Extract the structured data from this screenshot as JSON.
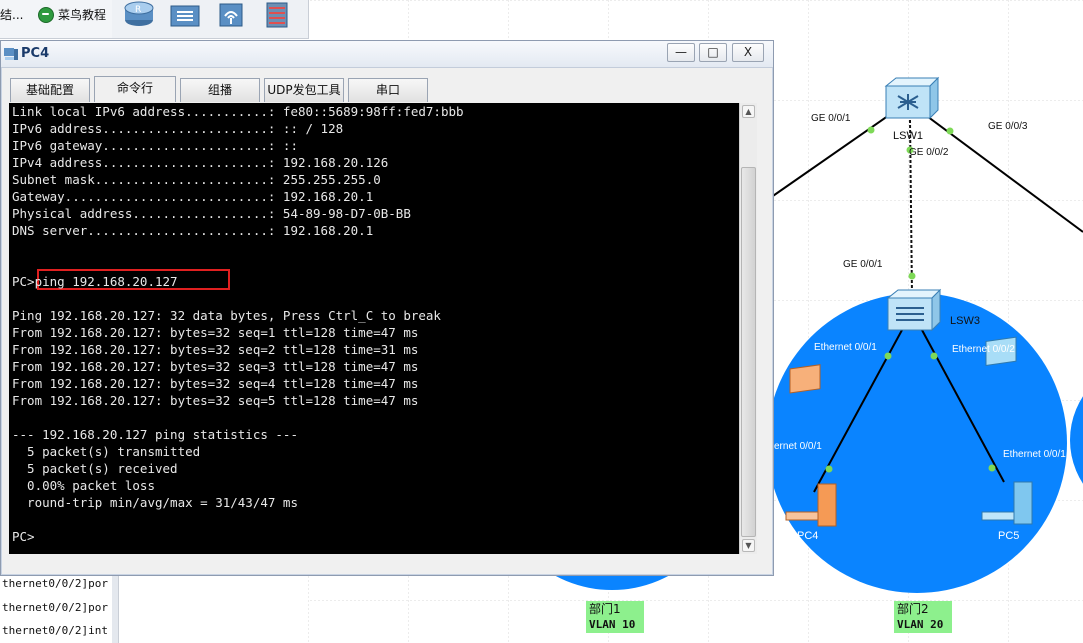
{
  "left_panel": {
    "tab_first": "结...",
    "tab_second": "菜鸟教程",
    "log_lines": [
      "thernet0/0/2]por",
      "thernet0/0/2]por",
      "thernet0/0/2]int"
    ]
  },
  "toolbar": {
    "icons": [
      "router-icon",
      "switch-icon",
      "wireless-icon",
      "firewall-icon"
    ]
  },
  "window": {
    "title": "PC4",
    "min_label": "—",
    "max_label": "□",
    "close_label": "X",
    "tabs": [
      "基础配置",
      "命令行",
      "组播",
      "UDP发包工具",
      "串口"
    ],
    "active_tab": "命令行"
  },
  "console": {
    "lines": [
      "Link local IPv6 address...........: fe80::5689:98ff:fed7:bbb",
      "IPv6 address......................: :: / 128",
      "IPv6 gateway......................: ::",
      "IPv4 address......................: 192.168.20.126",
      "Subnet mask.......................: 255.255.255.0",
      "Gateway...........................: 192.168.20.1",
      "Physical address..................: 54-89-98-D7-0B-BB",
      "DNS server........................: 192.168.20.1",
      "",
      "",
      "PC>ping 192.168.20.127",
      "",
      "Ping 192.168.20.127: 32 data bytes, Press Ctrl_C to break",
      "From 192.168.20.127: bytes=32 seq=1 ttl=128 time=47 ms",
      "From 192.168.20.127: bytes=32 seq=2 ttl=128 time=31 ms",
      "From 192.168.20.127: bytes=32 seq=3 ttl=128 time=47 ms",
      "From 192.168.20.127: bytes=32 seq=4 ttl=128 time=47 ms",
      "From 192.168.20.127: bytes=32 seq=5 ttl=128 time=47 ms",
      "",
      "--- 192.168.20.127 ping statistics ---",
      "  5 packet(s) transmitted",
      "  5 packet(s) received",
      "  0.00% packet loss",
      "  round-trip min/avg/max = 31/43/47 ms",
      "",
      "PC>"
    ],
    "highlighted_command": "ping 192.168.20.127"
  },
  "topology": {
    "devices": {
      "lsw1": "LSW1",
      "lsw3": "LSW3",
      "pc4": "PC4",
      "pc5": "PC5"
    },
    "ports": {
      "lsw1_left": "GE 0/0/1",
      "lsw1_down": "GE 0/0/2",
      "lsw1_right": "GE 0/0/3",
      "lsw3_up": "GE 0/0/1",
      "lsw3_left": "Ethernet 0/0/1",
      "lsw3_right": "Ethernet 0/0/2",
      "pc4_port": "ernet 0/0/1",
      "pc5_port": "Ethernet 0/0/1"
    },
    "groups": [
      {
        "name": "部门1",
        "vlan": "VLAN 10"
      },
      {
        "name": "部门2",
        "vlan": "VLAN 20"
      }
    ],
    "colors": {
      "zone_blue": "#0a84ff",
      "port_dot": "#7ed957",
      "vlan_tag": "#8df08d"
    }
  }
}
